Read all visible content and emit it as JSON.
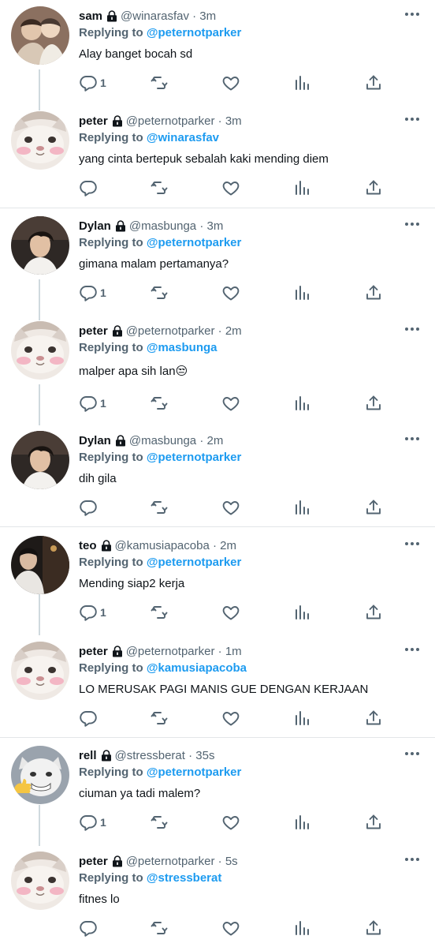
{
  "icons": {
    "lock": "lock-icon",
    "more": "more-icon",
    "reply": "reply-icon",
    "retweet": "retweet-icon",
    "like": "like-icon",
    "views": "views-icon",
    "share": "share-icon"
  },
  "colors": {
    "link": "#1d9bf0",
    "muted": "#536471",
    "text": "#0f1419",
    "line": "#cfd9de"
  },
  "tweets": [
    {
      "name": "sam",
      "handle": "@winarasfav",
      "time": "· 3m",
      "replying_label": "Replying to",
      "replying_to": "@peternotparker",
      "text": "Alay banget bocah sd",
      "reply_count": "1"
    },
    {
      "name": "peter",
      "handle": "@peternotparker",
      "time": "· 3m",
      "replying_label": "Replying to",
      "replying_to": "@winarasfav",
      "text": "yang cinta bertepuk sebalah kaki mending diem",
      "reply_count": ""
    },
    {
      "name": "Dylan",
      "handle": "@masbunga",
      "time": "· 3m",
      "replying_label": "Replying to",
      "replying_to": "@peternotparker",
      "text": "gimana malam pertamanya?",
      "reply_count": "1"
    },
    {
      "name": "peter",
      "handle": "@peternotparker",
      "time": "· 2m",
      "replying_label": "Replying to",
      "replying_to": "@masbunga",
      "text": "malper apa sih lan😒",
      "reply_count": "1"
    },
    {
      "name": "Dylan",
      "handle": "@masbunga",
      "time": "· 2m",
      "replying_label": "Replying to",
      "replying_to": "@peternotparker",
      "text": "dih gila",
      "reply_count": ""
    },
    {
      "name": "teo",
      "handle": "@kamusiapacoba",
      "time": "· 2m",
      "replying_label": "Replying to",
      "replying_to": "@peternotparker",
      "text": "Mending siap2 kerja",
      "reply_count": "1"
    },
    {
      "name": "peter",
      "handle": "@peternotparker",
      "time": "· 1m",
      "replying_label": "Replying to",
      "replying_to": "@kamusiapacoba",
      "text": "LO MERUSAK PAGI MANIS GUE DENGAN KERJAAN",
      "reply_count": ""
    },
    {
      "name": "rell",
      "handle": "@stressberat",
      "time": "· 35s",
      "replying_label": "Replying to",
      "replying_to": "@peternotparker",
      "text": "ciuman ya tadi malem?",
      "reply_count": "1"
    },
    {
      "name": "peter",
      "handle": "@peternotparker",
      "time": "· 5s",
      "replying_label": "Replying to",
      "replying_to": "@stressberat",
      "text": "fitnes lo",
      "reply_count": ""
    }
  ]
}
